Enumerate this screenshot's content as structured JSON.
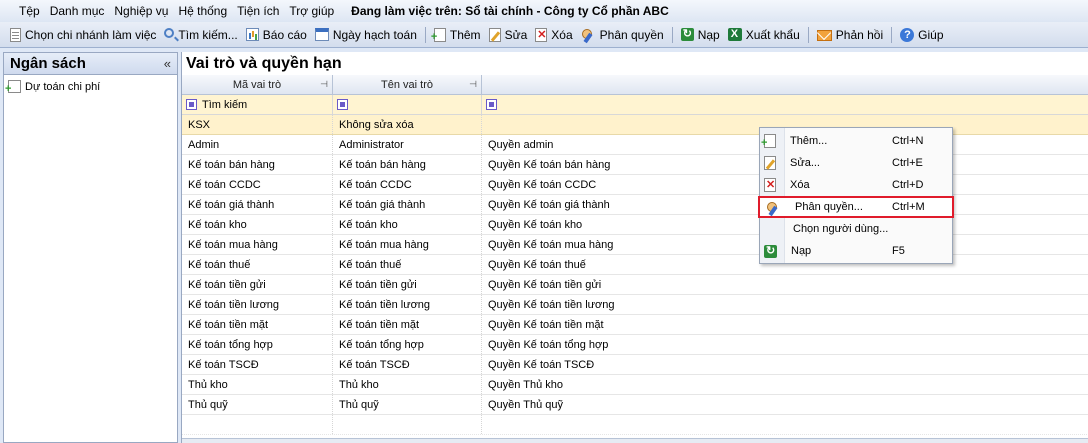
{
  "menubar": {
    "items": [
      "Tệp",
      "Danh mục",
      "Nghiệp vụ",
      "Hệ thống",
      "Tiện ích",
      "Trợ giúp"
    ],
    "working_on": "Đang làm việc trên: Sổ tài chính - Công ty Cổ phần ABC"
  },
  "toolbar": {
    "branch": "Chọn chi nhánh làm việc",
    "search": "Tìm kiếm...",
    "report": "Báo cáo",
    "date": "Ngày hạch toán",
    "add": "Thêm",
    "edit": "Sửa",
    "delete": "Xóa",
    "permission": "Phân quyền",
    "load": "Nạp",
    "export": "Xuất khẩu",
    "feedback": "Phản hồi",
    "help": "Giúp"
  },
  "left_panel": {
    "title": "Ngân sách",
    "collapse": "«",
    "items": [
      {
        "label": "Dự toán chi phí"
      }
    ]
  },
  "main": {
    "title": "Vai trò và quyền hạn",
    "columns": [
      "Mã vai trò",
      "Tên vai trò",
      ""
    ],
    "filter_label": "Tìm kiếm",
    "rows": [
      [
        "KSX",
        "Không sửa xóa",
        ""
      ],
      [
        "Admin",
        "Administrator",
        "Quyền admin"
      ],
      [
        "Kế toán bán hàng",
        "Kế toán bán hàng",
        "Quyền Kế toán bán hàng"
      ],
      [
        "Kế toán CCDC",
        "Kế toán CCDC",
        "Quyền Kế toán CCDC"
      ],
      [
        "Kế toán giá thành",
        "Kế toán giá thành",
        "Quyền Kế toán giá thành"
      ],
      [
        "Kế toán kho",
        "Kế toán kho",
        "Quyền Kế toán kho"
      ],
      [
        "Kế toán mua hàng",
        "Kế toán mua hàng",
        "Quyền Kế toán mua hàng"
      ],
      [
        "Kế toán thuế",
        "Kế toán thuế",
        "Quyền Kế toán thuế"
      ],
      [
        "Kế toán tiền gửi",
        "Kế toán tiền gửi",
        "Quyền Kế toán tiền gửi"
      ],
      [
        "Kế toán tiền lương",
        "Kế toán tiền lương",
        "Quyền Kế toán tiền lương"
      ],
      [
        "Kế toán tiền mặt",
        "Kế toán tiền mặt",
        "Quyền Kế toán tiền mặt"
      ],
      [
        "Kế toán tổng hợp",
        "Kế toán tổng hợp",
        "Quyền Kế toán tổng hợp"
      ],
      [
        "Kế toán TSCĐ",
        "Kế toán TSCĐ",
        "Quyền Kế toán TSCĐ"
      ],
      [
        "Thủ kho",
        "Thủ kho",
        "Quyền Thủ kho"
      ],
      [
        "Thủ quỹ",
        "Thủ quỹ",
        "Quyền Thủ quỹ"
      ]
    ]
  },
  "context_menu": {
    "items": [
      {
        "label": "Thêm...",
        "shortcut": "Ctrl+N"
      },
      {
        "label": "Sửa...",
        "shortcut": "Ctrl+E"
      },
      {
        "label": "Xóa",
        "shortcut": "Ctrl+D"
      },
      {
        "label": "Phân quyền...",
        "shortcut": "Ctrl+M"
      },
      {
        "label": "Chọn người dùng...",
        "shortcut": ""
      },
      {
        "label": "Nạp",
        "shortcut": "F5"
      }
    ]
  },
  "colors": {
    "highlight_border": "#e01b2b",
    "selected_row": "#fff2cc",
    "filter_row": "#fff4d1"
  }
}
